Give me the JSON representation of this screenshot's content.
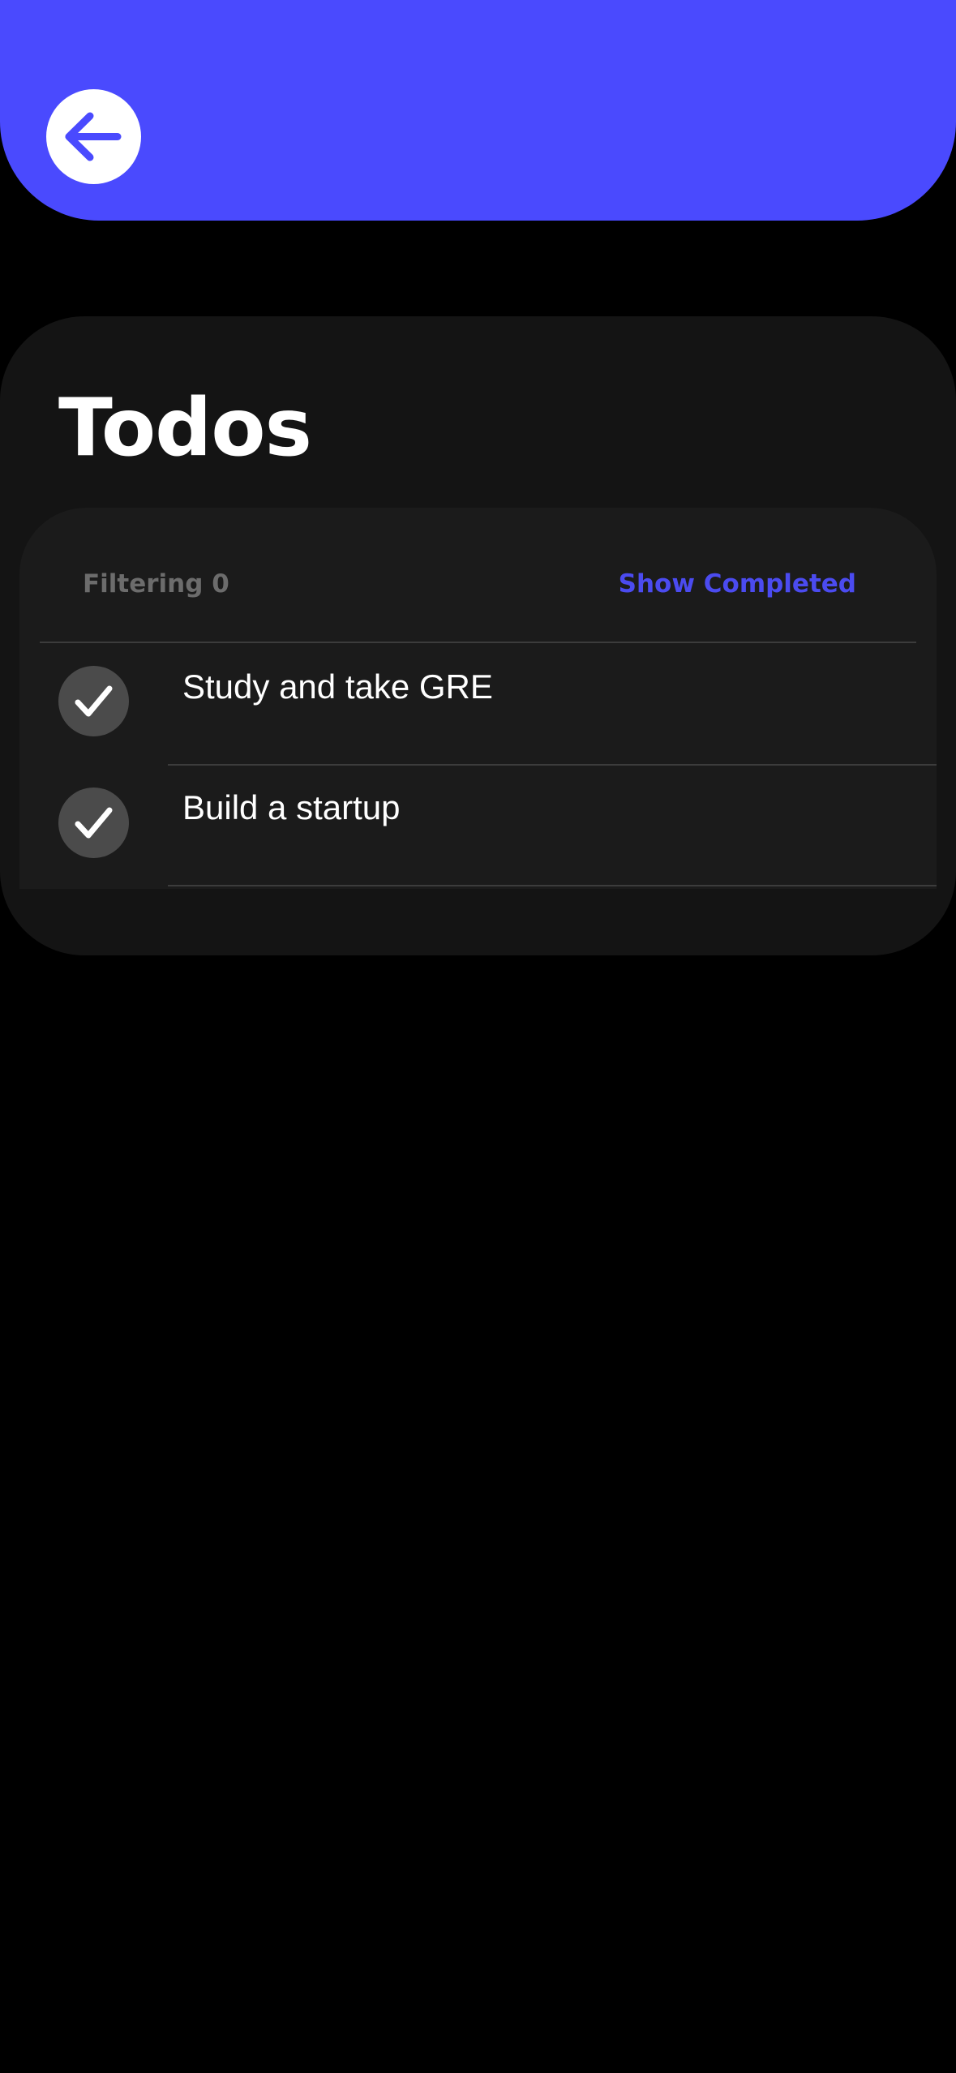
{
  "header": {
    "back_icon": "arrow-left-icon",
    "accent_color": "#4a4afe"
  },
  "page": {
    "title": "Todos"
  },
  "filter": {
    "label": "Filtering 0",
    "show_completed_label": "Show Completed",
    "link_color": "#4b4bf0"
  },
  "todos": [
    {
      "text": "Study and take GRE",
      "icon": "checkmark-icon"
    },
    {
      "text": "Build a startup",
      "icon": "checkmark-icon"
    }
  ]
}
